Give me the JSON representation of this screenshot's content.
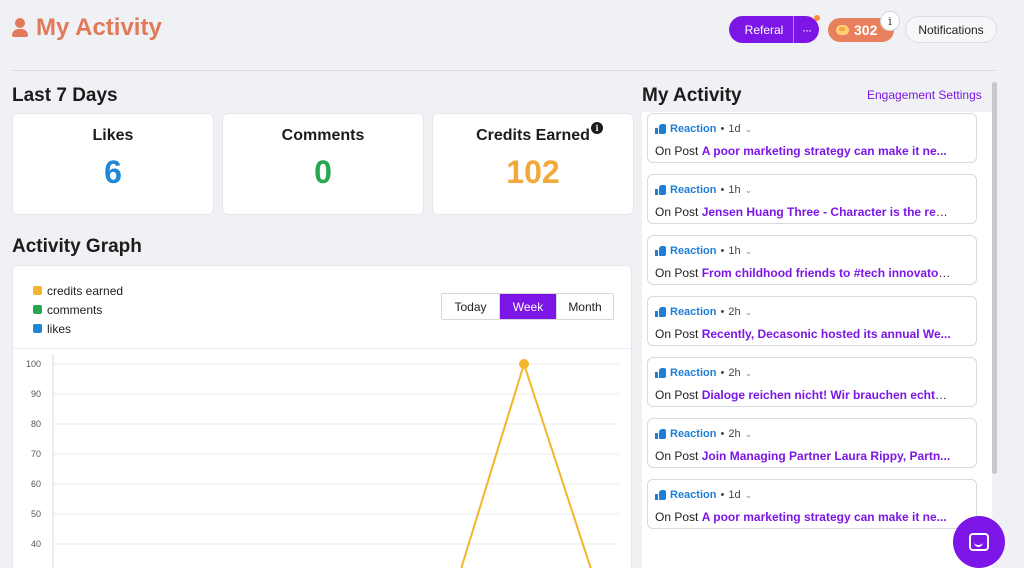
{
  "header": {
    "title": "My Activity",
    "referral_label": "Referal",
    "referral_more": "···",
    "credits_value": "302",
    "info_label": "i",
    "notifications_label": "Notifications"
  },
  "stats": {
    "section_title": "Last 7 Days",
    "likes": {
      "label": "Likes",
      "value": "6",
      "color": "#1e88d6"
    },
    "comments": {
      "label": "Comments",
      "value": "0",
      "color": "#27a74f"
    },
    "credits": {
      "label": "Credits Earned",
      "value": "102",
      "color": "#f2a93b"
    }
  },
  "graph": {
    "section_title": "Activity Graph",
    "legend": [
      {
        "label": "credits earned",
        "color": "#f4b52c"
      },
      {
        "label": "comments",
        "color": "#27a74f"
      },
      {
        "label": "likes",
        "color": "#1e88d6"
      }
    ],
    "range_tabs": [
      "Today",
      "Week",
      "Month"
    ],
    "active_tab": "Week"
  },
  "chart_data": {
    "type": "line",
    "series": [
      {
        "name": "credits earned",
        "color": "#f4b52c",
        "peak_value": 100
      }
    ],
    "y_ticks": [
      100,
      90,
      80,
      70,
      60,
      50,
      40
    ],
    "ylim": [
      0,
      100
    ],
    "grid": true
  },
  "feed": {
    "section_title": "My Activity",
    "settings_link": "Engagement Settings",
    "items": [
      {
        "type": "Reaction",
        "time": "1d",
        "prefix": "On Post",
        "post": "A poor marketing strategy can make it ne..."
      },
      {
        "type": "Reaction",
        "time": "1h",
        "prefix": "On Post",
        "post": "Jensen Huang Three - Character is the res..."
      },
      {
        "type": "Reaction",
        "time": "1h",
        "prefix": "On Post",
        "post": "From childhood friends to #tech innovator..."
      },
      {
        "type": "Reaction",
        "time": "2h",
        "prefix": "On Post",
        "post": "Recently, Decasonic hosted its annual We..."
      },
      {
        "type": "Reaction",
        "time": "2h",
        "prefix": "On Post",
        "post": "Dialoge reichen nicht! Wir brauchen echte ..."
      },
      {
        "type": "Reaction",
        "time": "2h",
        "prefix": "On Post",
        "post": "Join Managing Partner Laura Rippy, Partn..."
      },
      {
        "type": "Reaction",
        "time": "1d",
        "prefix": "On Post",
        "post": "A poor marketing strategy can make it ne..."
      }
    ]
  }
}
